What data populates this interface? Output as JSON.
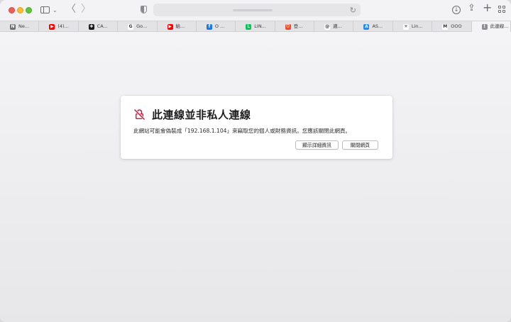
{
  "window": {
    "url_text": "",
    "tabs": [
      {
        "label": "Ne...",
        "icon": "notion-n-icon",
        "badge": "N",
        "color": "#6e6e73"
      },
      {
        "label": "(4)...",
        "icon": "youtube-icon",
        "badge": "▶",
        "color": "#ff0000"
      },
      {
        "label": "CA...",
        "icon": "ca-app-icon",
        "badge": "✚",
        "color": "#1a1a1a"
      },
      {
        "label": "Go...",
        "icon": "google-icon",
        "badge": "G",
        "color": "#ffffff"
      },
      {
        "label": "給...",
        "icon": "youtube-icon",
        "badge": "▶",
        "color": "#ff0000"
      },
      {
        "label": "O ...",
        "icon": "facebook-icon",
        "badge": "f",
        "color": "#1877f2"
      },
      {
        "label": "LIN...",
        "icon": "line-icon",
        "badge": "L",
        "color": "#06c755"
      },
      {
        "label": "登...",
        "icon": "shopping-bag-icon",
        "badge": "⛉",
        "color": "#ee4d2d"
      },
      {
        "label": "適...",
        "icon": "swirl-app-icon",
        "badge": "@",
        "color": "#ffffff"
      },
      {
        "label": "AS...",
        "icon": "app-store-icon",
        "badge": "A",
        "color": "#1d8cf8"
      },
      {
        "label": "Lin...",
        "icon": "star-burst-icon",
        "badge": "✳",
        "color": "#ffffff"
      },
      {
        "label": "OOO",
        "icon": "medium-m-icon",
        "badge": "M",
        "color": "#ffffff"
      },
      {
        "label": "此連線...",
        "icon": "warning-page-icon",
        "badge": "!",
        "color": "#8e8e93"
      }
    ]
  },
  "dialog": {
    "title": "此連線並非私人連線",
    "message": "此網站可能會偽裝成「192.168.1.104」來竊取您的個人或財務資訊。您應該關閉此網頁。",
    "details_button": "顯示詳細資訊",
    "close_button": "關閉網頁",
    "accent_color": "#c8193c"
  }
}
